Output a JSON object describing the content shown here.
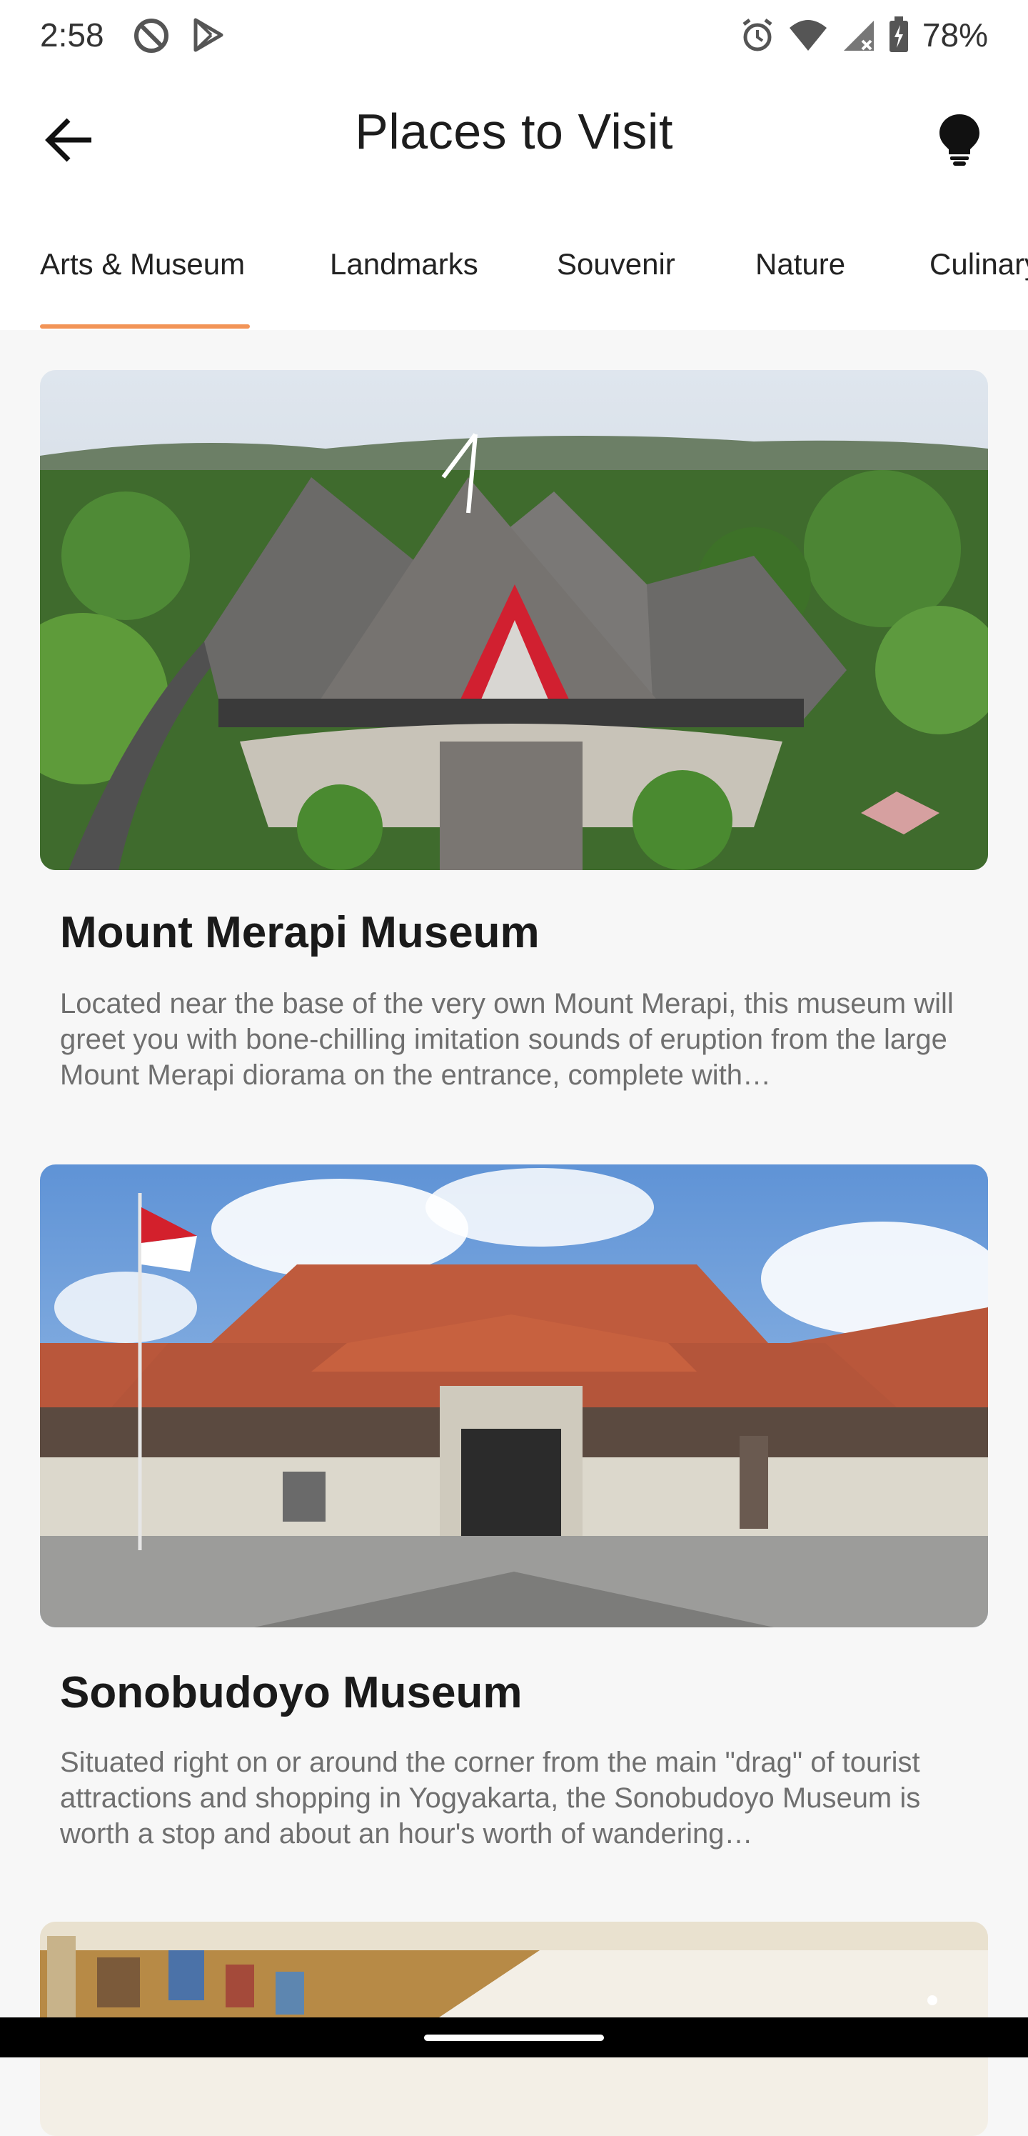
{
  "status_bar": {
    "time": "2:58",
    "battery_percent": "78%",
    "icons_left": [
      "do-not-disturb-icon",
      "play-store-icon"
    ],
    "icons_right": [
      "alarm-icon",
      "wifi-icon",
      "signal-icon",
      "battery-icon"
    ]
  },
  "app_bar": {
    "title": "Places to Visit",
    "back_icon": "arrow-left-icon",
    "action_icon": "lightbulb-icon"
  },
  "tabs": {
    "items": [
      {
        "label": "Arts & Museum",
        "selected": true
      },
      {
        "label": "Landmarks",
        "selected": false
      },
      {
        "label": "Souvenir",
        "selected": false
      },
      {
        "label": "Nature",
        "selected": false
      },
      {
        "label": "Culinary",
        "selected": false
      }
    ],
    "accent_color": "#f29457"
  },
  "places": [
    {
      "title": "Mount Merapi Museum",
      "description": "Located near the base of the very own Mount Merapi, this museum will greet you with bone-chilling imitation sounds of eruption from the large Mount Merapi diorama on the entrance, complete with…"
    },
    {
      "title": "Sonobudoyo Museum",
      "description": "Situated right on or around the corner from the main \"drag\" of tourist attractions and shopping in Yogyakarta, the Sonobudoyo Museum is worth a stop and about an hour's worth of wandering…"
    }
  ]
}
